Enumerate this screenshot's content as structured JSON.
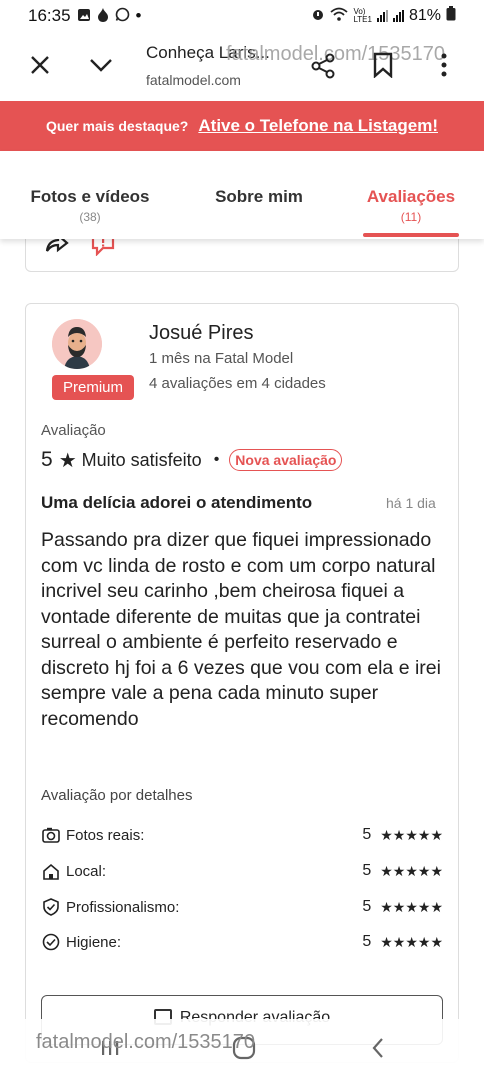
{
  "status_bar": {
    "time": "16:35",
    "battery_percent": "81%",
    "network_label_top": "Vo)",
    "network_label_bottom": "LTE1"
  },
  "browser": {
    "page_title": "Conheça Laris...",
    "domain": "fatalmodel.com",
    "overlay_url": "fatalmodel.com/1535170"
  },
  "banner": {
    "question": "Quer mais destaque?",
    "cta": "Ative o Telefone na Listagem!"
  },
  "tabs": [
    {
      "label": "Fotos e vídeos",
      "count": "(38)"
    },
    {
      "label": "Sobre mim",
      "count": ""
    },
    {
      "label": "Avaliações",
      "count": "(11)"
    }
  ],
  "review": {
    "name": "Josué Pires",
    "member_since": "1 mês na Fatal Model",
    "review_count": "4 avaliações em 4 cidades",
    "badge": "Premium",
    "rating_label": "Avaliação",
    "rating_value": "5",
    "rating_text": "Muito satisfeito",
    "new_badge": "Nova avaliação",
    "title": "Uma delícia adorei o atendimento",
    "time": "há 1 dia",
    "body": "Passando pra dizer que fiquei impressionado com vc linda de rosto e com um corpo natural incrivel seu carinho ,bem cheirosa fiquei a vontade diferente de muitas que ja contratei surreal o ambiente é perfeito reservado e discreto hj foi a 6 vezes que vou com ela e irei sempre vale a pena cada minuto super recomendo",
    "details_label": "Avaliação por detalhes",
    "details": [
      {
        "label": "Fotos reais:",
        "score": "5",
        "stars": "★★★★★"
      },
      {
        "label": "Local:",
        "score": "5",
        "stars": "★★★★★"
      },
      {
        "label": "Profissionalismo:",
        "score": "5",
        "stars": "★★★★★"
      },
      {
        "label": "Higiene:",
        "score": "5",
        "stars": "★★★★★"
      }
    ],
    "reply_label": "Responder avaliação"
  },
  "watermark": "fatalmodel.com/1535170",
  "colors": {
    "accent": "#e55353",
    "text": "#222222",
    "muted": "#888888"
  }
}
